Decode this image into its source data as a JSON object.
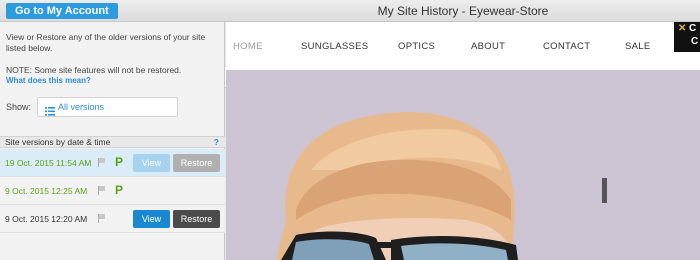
{
  "header": {
    "account_button": "Go to My Account",
    "title": "My Site History - Eyewear-Store"
  },
  "panel": {
    "intro": "View or Restore any of the older versions of your site listed below.",
    "note": "NOTE: Some site features will not be restored.",
    "note_link": "What does this mean?",
    "show_label": "Show:",
    "show_value": "All versions",
    "collapse_icon": "chevron-left-icon",
    "list_header": "Site versions by date & time",
    "help": "?",
    "versions": [
      {
        "date": "19 Oct. 2015 11:54 AM",
        "published": "P",
        "view": "View",
        "restore": "Restore"
      },
      {
        "date": "9 Oct. 2015 12:25 AM",
        "published": "P"
      },
      {
        "date": "9 Oct. 2015 12:20 AM",
        "view": "View",
        "restore": "Restore"
      }
    ]
  },
  "preview": {
    "nav": [
      "HOME",
      "SUNGLASSES",
      "OPTICS",
      "ABOUT",
      "CONTACT",
      "SALE"
    ],
    "active_nav": "HOME"
  },
  "colors": {
    "accent": "#2d9be0",
    "published_green": "#5aa319",
    "current_date_green": "#5aa319",
    "preview_bg": "#cdc4d3"
  }
}
